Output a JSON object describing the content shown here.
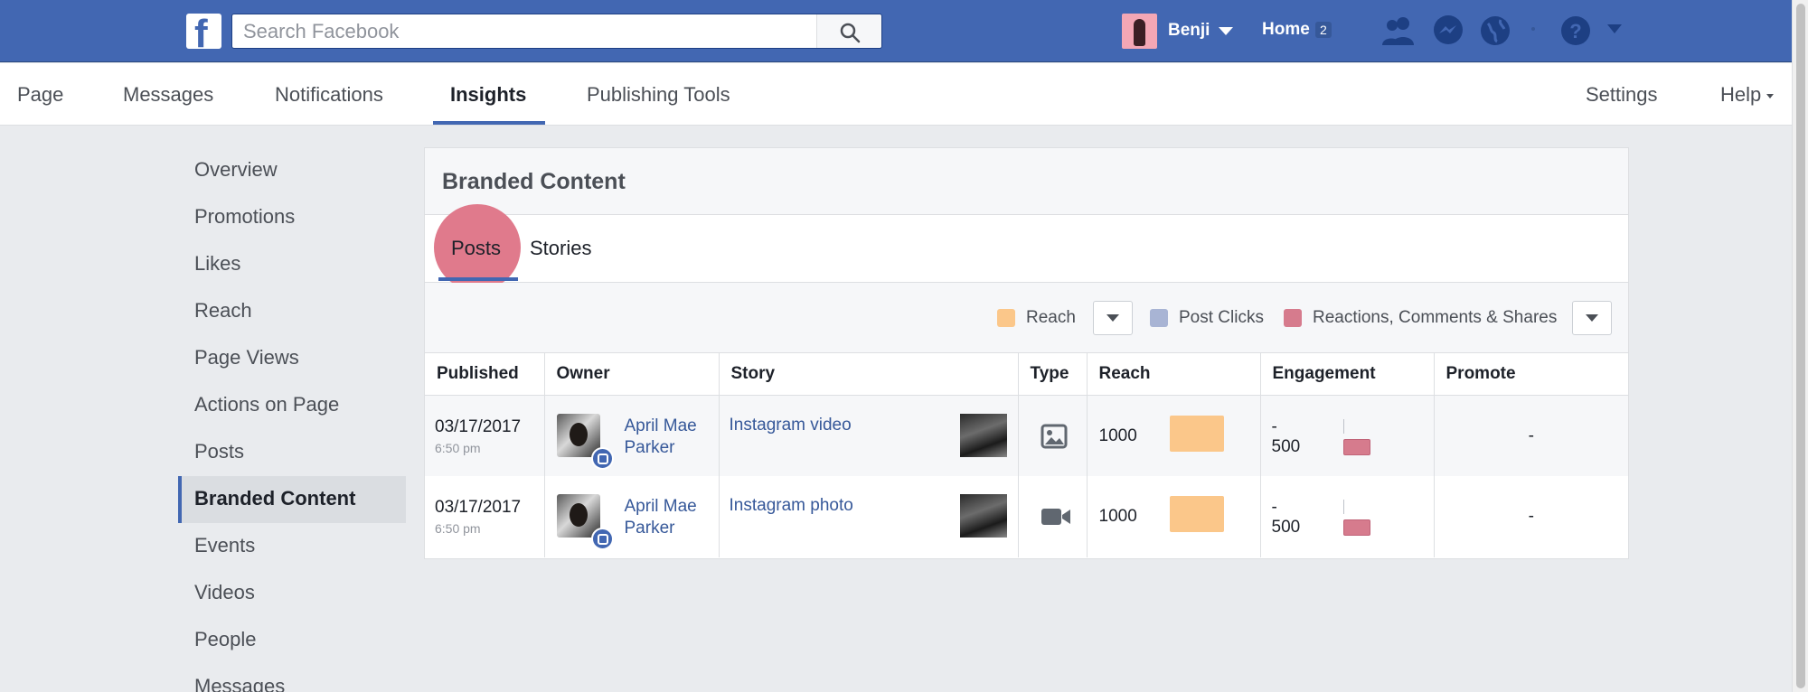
{
  "header": {
    "logo_letter": "f",
    "search_placeholder": "Search Facebook",
    "user_name": "Benji",
    "home_label": "Home",
    "home_count": "2"
  },
  "page_nav": {
    "tabs": [
      "Page",
      "Messages",
      "Notifications",
      "Insights",
      "Publishing Tools"
    ],
    "active_tab": "Insights",
    "settings_label": "Settings",
    "help_label": "Help"
  },
  "sidebar": {
    "items": [
      "Overview",
      "Promotions",
      "Likes",
      "Reach",
      "Page Views",
      "Actions on Page",
      "Posts",
      "Branded Content",
      "Events",
      "Videos",
      "People",
      "Messages"
    ],
    "active_item": "Branded Content"
  },
  "panel": {
    "title": "Branded Content",
    "tabs": [
      "Posts",
      "Stories"
    ],
    "active_tab": "Posts",
    "legend": [
      {
        "label": "Reach",
        "color": "#fbc78a"
      },
      {
        "label": "Post Clicks",
        "color": "#a8b4d4"
      },
      {
        "label": "Reactions, Comments & Shares",
        "color": "#d67b8d"
      }
    ]
  },
  "table": {
    "columns": [
      "Published",
      "Owner",
      "Story",
      "Type",
      "Reach",
      "Engagement",
      "Promote"
    ],
    "rows": [
      {
        "date": "03/17/2017",
        "time": "6:50 pm",
        "owner_line1": "April Mae",
        "owner_line2": "Parker",
        "story": "Instagram video",
        "type_icon": "image-icon",
        "reach": "1000",
        "engagement_top": "-",
        "engagement": "500",
        "promote": "-"
      },
      {
        "date": "03/17/2017",
        "time": "6:50 pm",
        "owner_line1": "April Mae",
        "owner_line2": "Parker",
        "story": "Instagram photo",
        "type_icon": "video-camera-icon",
        "reach": "1000",
        "engagement_top": "-",
        "engagement": "500",
        "promote": "-"
      }
    ]
  }
}
